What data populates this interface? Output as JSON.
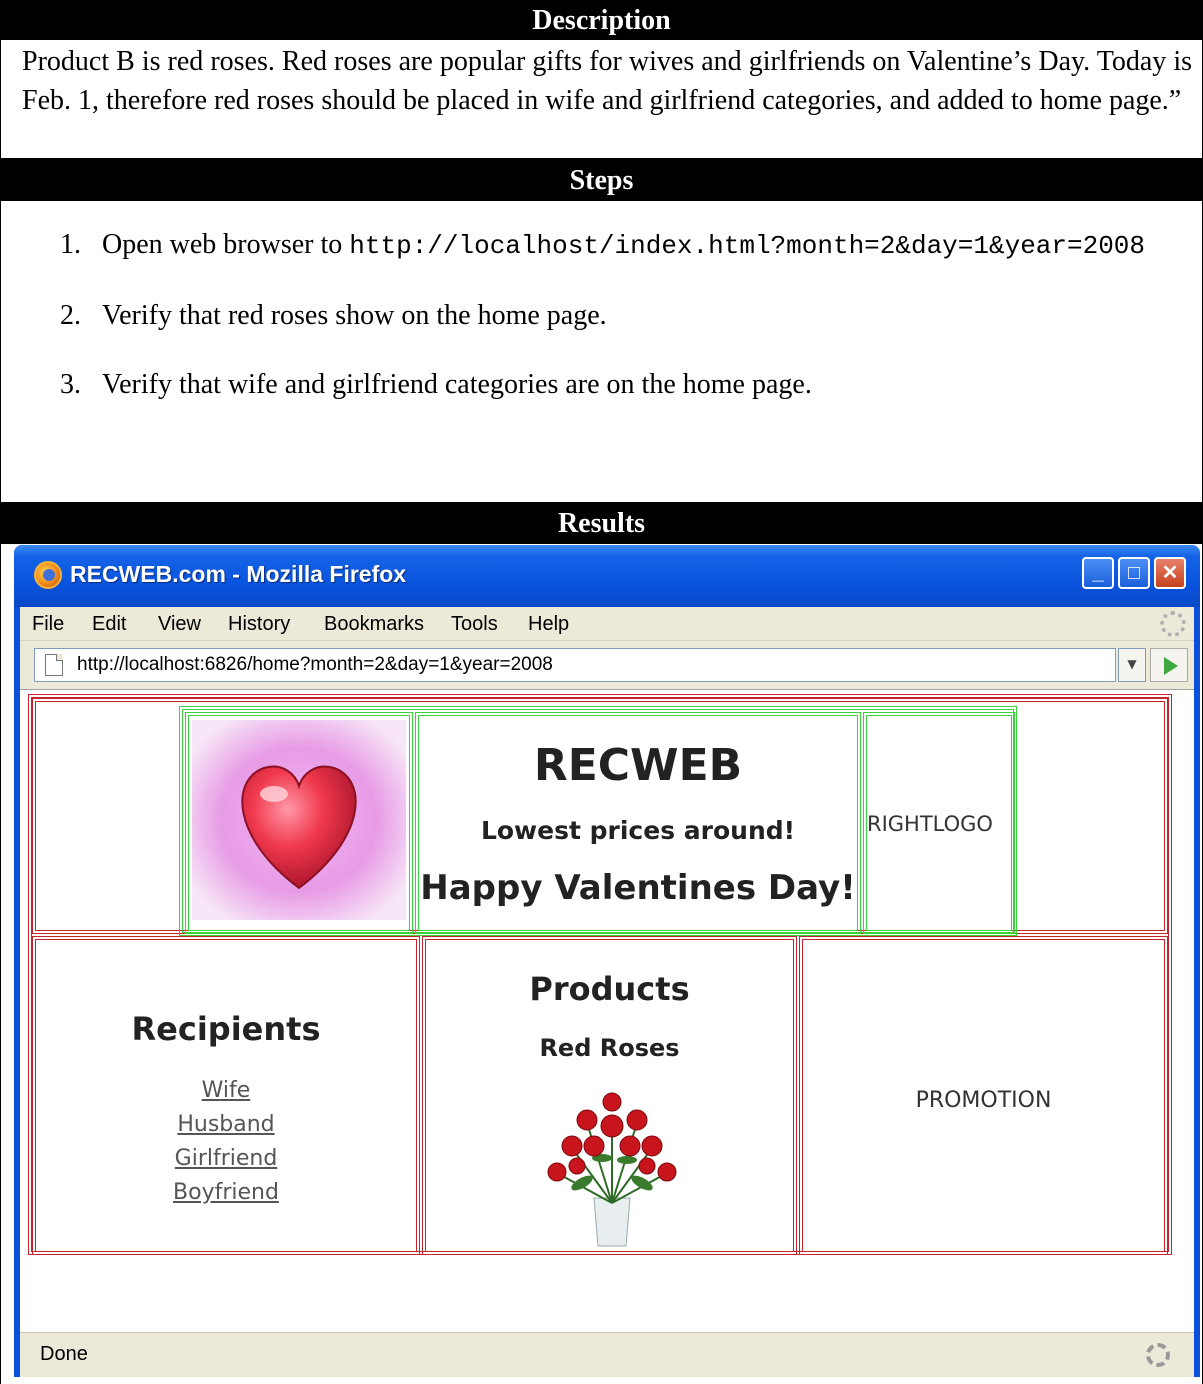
{
  "description": {
    "header": "Description",
    "text": "Product B is red roses. Red roses are popular gifts for wives and girlfriends on Valentine’s Day. Today is Feb. 1, therefore red roses should be placed in wife and girlfriend categories, and added to home page.”"
  },
  "steps": {
    "header": "Steps",
    "items": [
      {
        "num": "1.",
        "prefix": "Open web browser to ",
        "url": "http://localhost/index.html?month=2&day=1&year=2008"
      },
      {
        "num": "2.",
        "text": "Verify that red roses show on the home page."
      },
      {
        "num": "3.",
        "text": "Verify that wife and girlfriend categories are on the home page."
      }
    ]
  },
  "results": {
    "header": "Results"
  },
  "browser": {
    "window_title": "RECWEB.com - Mozilla Firefox",
    "buttons": {
      "minimize": "_",
      "maximize": "□",
      "close": "✕"
    },
    "menu": [
      "File",
      "Edit",
      "View",
      "History",
      "Bookmarks",
      "Tools",
      "Help"
    ],
    "address": "http://localhost:6826/home?month=2&day=1&year=2008",
    "status": "Done",
    "icons": [
      "firefox-icon",
      "page-icon",
      "dropdown-icon",
      "go-icon",
      "throbber-icon",
      "gear-icon"
    ]
  },
  "page": {
    "site_title": "RECWEB",
    "tagline": "Lowest prices around!",
    "greeting": "Happy Valentines Day!",
    "right_logo": "RIGHTLOGO",
    "recipients_title": "Recipients",
    "recipients": [
      "Wife",
      "Husband",
      "Girlfriend",
      "Boyfriend"
    ],
    "products_title": "Products",
    "product_name": "Red Roses",
    "promotion": "PROMOTION",
    "colors": {
      "outer_border": "#c8232c",
      "header_border": "#37d437"
    }
  }
}
